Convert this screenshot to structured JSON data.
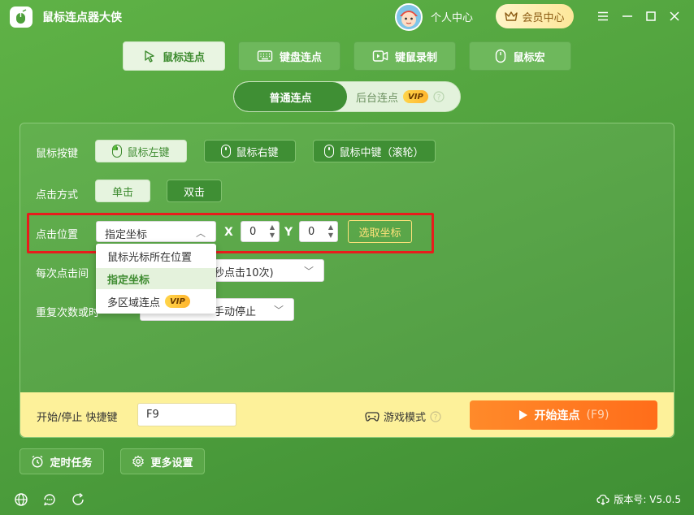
{
  "app": {
    "title": "鼠标连点器大侠"
  },
  "header": {
    "user_center": "个人中心",
    "vip_center": "会员中心"
  },
  "mode_tabs": [
    {
      "label": "鼠标连点",
      "icon": "cursor-icon",
      "active": true
    },
    {
      "label": "键盘连点",
      "icon": "keyboard-icon",
      "active": false
    },
    {
      "label": "键鼠录制",
      "icon": "video-icon",
      "active": false
    },
    {
      "label": "鼠标宏",
      "icon": "mouse-icon",
      "active": false
    }
  ],
  "sub_tabs": {
    "normal": "普通连点",
    "background": "后台连点",
    "vip": "VIP"
  },
  "mouse_button": {
    "label": "鼠标按键",
    "options": [
      "鼠标左键",
      "鼠标右键",
      "鼠标中键（滚轮）"
    ],
    "selected": "鼠标左键"
  },
  "click_mode": {
    "label": "点击方式",
    "options": [
      "单击",
      "双击"
    ],
    "selected": "单击"
  },
  "click_position": {
    "label": "点击位置",
    "selected": "指定坐标",
    "x_label": "X",
    "x_value": "0",
    "y_label": "Y",
    "y_value": "0",
    "pick_label": "选取坐标",
    "dropdown": [
      {
        "label": "鼠标光标所在位置",
        "selected": false
      },
      {
        "label": "指定坐标",
        "selected": true
      },
      {
        "label": "多区域连点",
        "selected": false,
        "vip": "VIP"
      }
    ]
  },
  "interval": {
    "label": "每次点击间",
    "value_partial": "秒点击10次)"
  },
  "repeat": {
    "label": "重复次数或时",
    "value_partial": "手动停止"
  },
  "footer": {
    "hotkey_label": "开始/停止 快捷键",
    "hotkey_value": "F9",
    "game_mode": "游戏模式",
    "start_label": "开始连点",
    "start_hotkey": "(F9)"
  },
  "bottom": {
    "timer_task": "定时任务",
    "more_settings": "更多设置",
    "version_label": "版本号: V5.0.5"
  },
  "colors": {
    "accent_green": "#3f8f34",
    "highlight_red": "#e81c1c",
    "start_orange": "#ff7a22",
    "footer_yellow": "#fdf19a"
  }
}
